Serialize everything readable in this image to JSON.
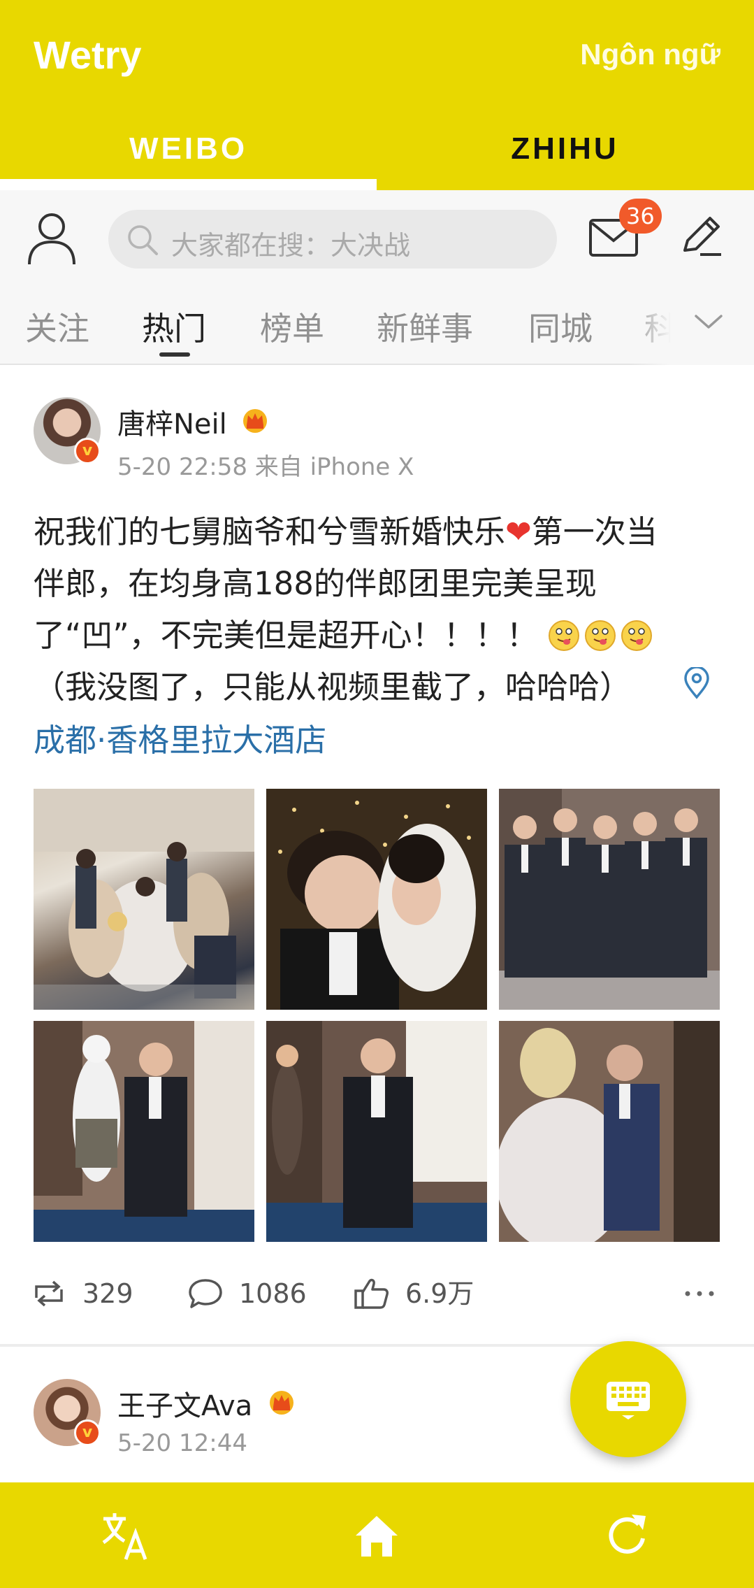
{
  "app": {
    "title": "Wetry",
    "language_button": "Ngôn ngữ",
    "accent_color": "#e8d800"
  },
  "tabs": [
    {
      "label": "WEIBO",
      "active": true
    },
    {
      "label": "ZHIHU",
      "active": false
    }
  ],
  "weibo_header": {
    "search_placeholder": "大家都在搜：大决战",
    "mail_badge": "36",
    "channels": [
      "关注",
      "热门",
      "榜单",
      "新鲜事",
      "同城",
      "科"
    ],
    "active_channel": "热门"
  },
  "posts": [
    {
      "author": "唐梓Neil",
      "meta": "5-20 22:58 来自 iPhone X",
      "text_lines": [
        "祝我们的七舅脑爷和兮雪新婚快乐",
        "第一次当",
        "伴郎，在均身高188的伴郎团里完美呈现",
        "了“凹”，不完美但是超开心！！！！",
        "（我没图了，只能从视频里截了，哈哈哈）"
      ],
      "location": "成都·香格里拉大酒店",
      "stats": {
        "reposts": "329",
        "comments": "1086",
        "likes": "6.9万"
      }
    },
    {
      "author": "王子文Ava",
      "meta": "5-20 12:44"
    }
  ],
  "icons": {
    "profile": "person-outline-icon",
    "search": "search-icon",
    "mail": "mail-icon",
    "edit": "pencil-icon",
    "more_channels": "chevron-down-icon",
    "location": "location-pin-icon",
    "repost": "repost-icon",
    "comment": "comment-icon",
    "like": "thumbs-up-icon",
    "more": "more-dots-icon",
    "fab": "keyboard-icon",
    "translate": "translate-icon",
    "home": "home-icon",
    "refresh": "refresh-icon"
  }
}
